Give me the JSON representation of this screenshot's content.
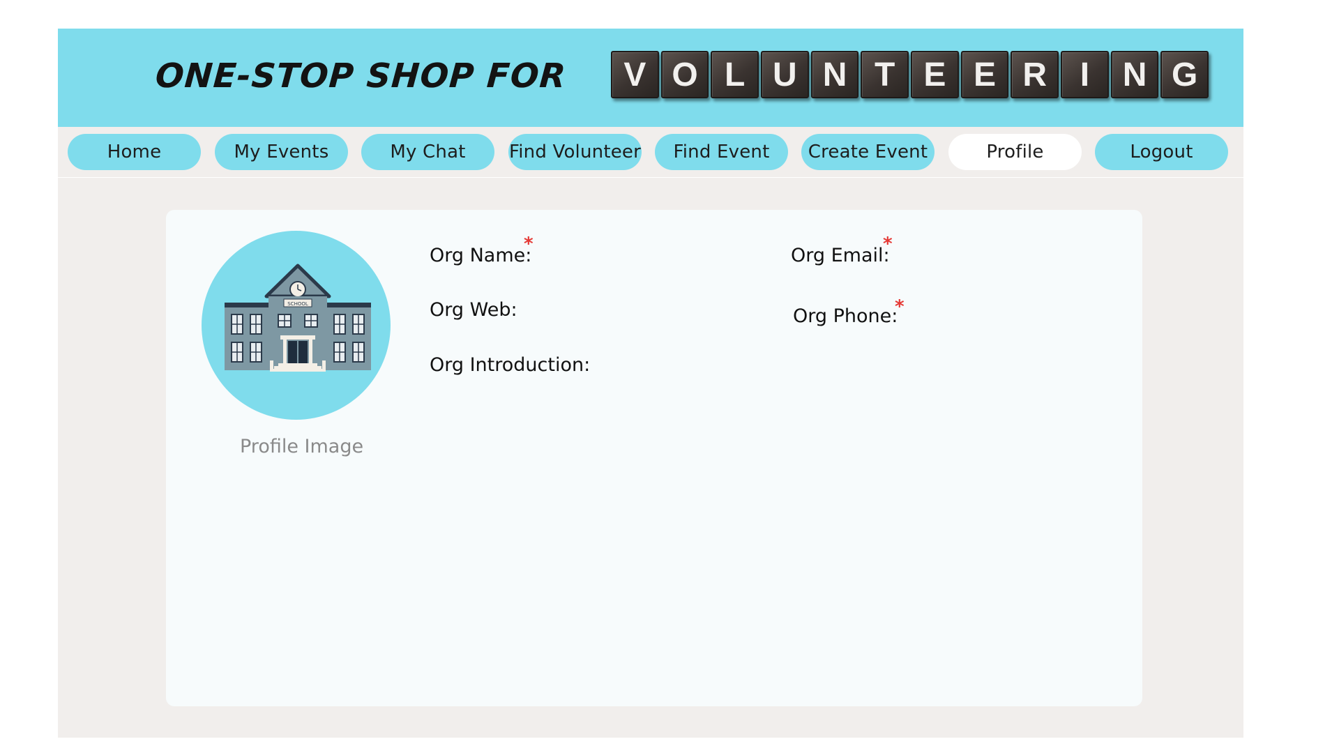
{
  "header": {
    "title": "ONE-STOP SHOP FOR",
    "tiles": [
      "V",
      "O",
      "L",
      "U",
      "N",
      "T",
      "E",
      "E",
      "R",
      "I",
      "N",
      "G"
    ]
  },
  "nav": {
    "items": [
      {
        "label": "Home"
      },
      {
        "label": "My Events"
      },
      {
        "label": "My Chat"
      },
      {
        "label": "Find Volunteer"
      },
      {
        "label": "Find Event"
      },
      {
        "label": "Create Event"
      },
      {
        "label": "Profile",
        "active": true
      },
      {
        "label": "Logout"
      }
    ]
  },
  "profile": {
    "avatar_caption": "Profile Image",
    "avatar_icon": "school-building-icon",
    "school_sign": "SCHOOL",
    "fields": {
      "org_name": "Org Name:",
      "org_email": "Org Email:",
      "org_web": "Org Web:",
      "org_phone": "Org Phone:",
      "org_intro": "Org Introduction:"
    },
    "required_marker": "*"
  },
  "colors": {
    "accent": "#7fdcec",
    "page_bg": "#f1eeec",
    "card_bg": "#f7fbfc",
    "required": "#e53935"
  }
}
